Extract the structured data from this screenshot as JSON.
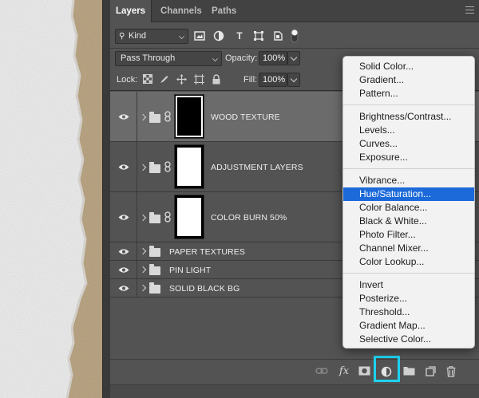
{
  "tabs": [
    {
      "label": "Layers",
      "active": true
    },
    {
      "label": "Channels",
      "active": false
    },
    {
      "label": "Paths",
      "active": false
    }
  ],
  "filter": {
    "kind_label": "Kind",
    "icons": [
      "image-filter-icon",
      "adjustment-filter-icon",
      "type-filter-icon",
      "shape-filter-icon",
      "smart-object-filter-icon",
      "filter-toggle-icon"
    ]
  },
  "blend": {
    "mode": "Pass Through",
    "opacity_label": "Opacity:",
    "opacity_value": "100%"
  },
  "lock": {
    "label": "Lock:",
    "fill_label": "Fill:",
    "fill_value": "100%"
  },
  "layers": [
    {
      "name": "WOOD TEXTURE",
      "selected": true,
      "thumb": "black"
    },
    {
      "name": "ADJUSTMENT LAYERS",
      "selected": false,
      "thumb": "white"
    },
    {
      "name": "COLOR BURN 50%",
      "selected": false,
      "thumb": "white"
    },
    {
      "name": "PAPER TEXTURES",
      "selected": false
    },
    {
      "name": "PIN LIGHT",
      "selected": false
    },
    {
      "name": "SOLID BLACK BG",
      "selected": false
    }
  ],
  "menu": {
    "groups": [
      [
        "Solid Color...",
        "Gradient...",
        "Pattern..."
      ],
      [
        "Brightness/Contrast...",
        "Levels...",
        "Curves...",
        "Exposure..."
      ],
      [
        "Vibrance...",
        "Hue/Saturation...",
        "Color Balance...",
        "Black & White...",
        "Photo Filter...",
        "Channel Mixer...",
        "Color Lookup..."
      ],
      [
        "Invert",
        "Posterize...",
        "Threshold...",
        "Gradient Map...",
        "Selective Color..."
      ]
    ],
    "highlighted": "Hue/Saturation..."
  },
  "bottom_icons": [
    "link-layers-icon",
    "fx-icon",
    "add-mask-icon",
    "adjustment-layer-icon",
    "new-group-icon",
    "new-layer-icon",
    "trash-icon"
  ],
  "bottom": {
    "fx_label": "fx"
  },
  "colors": {
    "highlight_ring": "#1dd2f0",
    "menu_selection": "#1c6ad9",
    "panel_bg": "#535353"
  }
}
